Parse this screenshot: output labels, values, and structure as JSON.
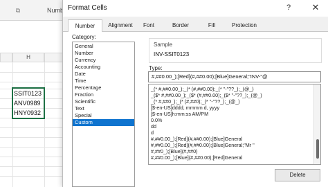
{
  "sheet": {
    "format_icon": "launcher-icon",
    "number_group_label": "Numbe",
    "column_header": "H",
    "cells": [
      "SSIT0123",
      "ANV0989",
      "HNY0932"
    ]
  },
  "dialog": {
    "title": "Format Cells",
    "help_glyph": "?",
    "close_glyph": "✕",
    "tabs": [
      "Number",
      "Alignment",
      "Font",
      "Border",
      "Fill",
      "Protection"
    ],
    "active_tab": "Number",
    "category_label": "Category:",
    "categories": [
      "General",
      "Number",
      "Currency",
      "Accounting",
      "Date",
      "Time",
      "Percentage",
      "Fraction",
      "Scientific",
      "Text",
      "Special",
      "Custom"
    ],
    "selected_category": "Custom",
    "sample_title": "Sample",
    "sample_value": "INV-SSIT0123",
    "type_label": "Type:",
    "type_value": "#,##0.00_);[Red](#,##0.00);[Blue]General;\"INV-\"@",
    "format_list": [
      "_(* #,##0.00_);_(* (#,##0.00);_(* \"-\"??_);_(@_)",
      "_($* #,##0.00_);_($* (#,##0.00);_($* \"-\"??_);_(@_)",
      "_(* #,##0_);_(* (#,##0);_(* \"-\"??_);_(@_)",
      "[$-en-US]dddd, mmmm d, yyyy",
      "[$-en-US]h:mm:ss AM/PM",
      "0.0%",
      "dd",
      "d",
      "#,##0.00_);[Red](#,##0.00);[Blue]General",
      "#,##0.00_);[Red](#,##0.00);[Blue]General;\"Mr \"",
      "#,##0_);[Blue](#,##0)",
      "#,##0.00_);[Blue](#,##0.00);[Red]General"
    ],
    "delete_label": "Delete"
  }
}
